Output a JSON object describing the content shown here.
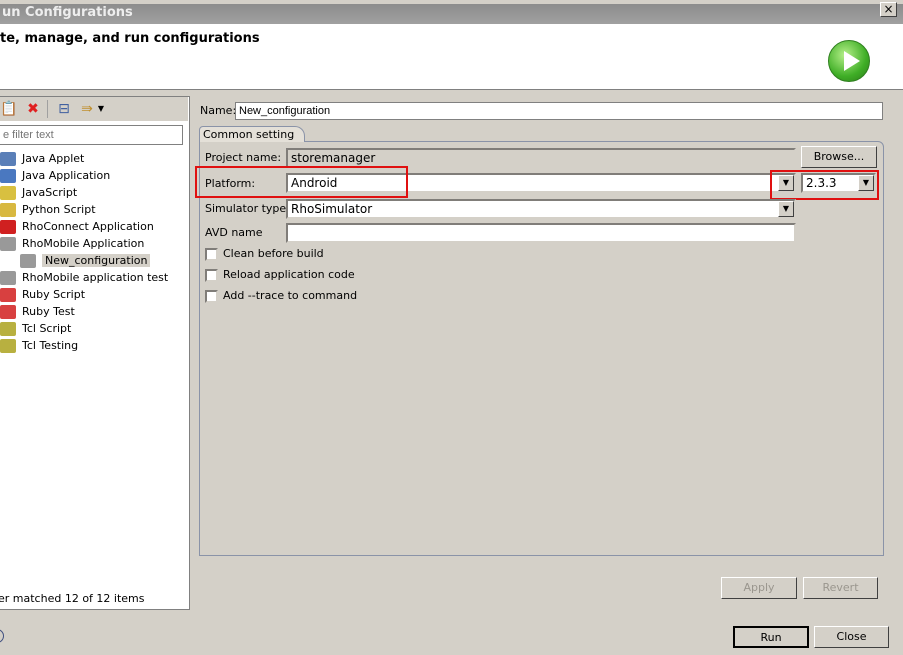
{
  "window": {
    "title": "un Configurations",
    "close": "×"
  },
  "header": {
    "title": "te, manage, and run configurations",
    "run_icon": "green-run-icon"
  },
  "toolbar": {
    "icons": [
      "duplicate-icon",
      "delete-icon",
      "collapse-all-icon",
      "filter-icon",
      "dropdown-arrow-icon"
    ]
  },
  "filter": {
    "placeholder": "e filter text"
  },
  "tree": {
    "items": [
      {
        "label": "Java Applet",
        "icon": "java-applet-icon",
        "color": "#5a7fb8"
      },
      {
        "label": "Java Application",
        "icon": "java-app-icon",
        "color": "#4a78c0"
      },
      {
        "label": "JavaScript",
        "icon": "javascript-icon",
        "color": "#d8c040"
      },
      {
        "label": "Python Script",
        "icon": "python-icon",
        "color": "#d8b840"
      },
      {
        "label": "RhoConnect Application",
        "icon": "rhoconnect-icon",
        "color": "#d02020"
      },
      {
        "label": "RhoMobile Application",
        "icon": "rhomobile-icon",
        "color": "#999999"
      },
      {
        "label": "New_configuration",
        "icon": "rhomobile-icon",
        "color": "#999999",
        "child": true,
        "selected": true
      },
      {
        "label": "RhoMobile application test",
        "icon": "rhomobile-icon",
        "color": "#999999"
      },
      {
        "label": "Ruby Script",
        "icon": "ruby-icon",
        "color": "#d84040"
      },
      {
        "label": "Ruby Test",
        "icon": "ruby-test-icon",
        "color": "#d84040"
      },
      {
        "label": "Tcl Script",
        "icon": "tcl-icon",
        "color": "#b8b040"
      },
      {
        "label": "Tcl Testing",
        "icon": "tcl-icon",
        "color": "#b8b040"
      }
    ]
  },
  "status": "er matched 12 of 12 items",
  "name": {
    "label": "Name:",
    "value": "New_configuration"
  },
  "tab": {
    "label": "Common setting"
  },
  "form": {
    "project_label": "Project name:",
    "project_value": "storemanager",
    "browse": "Browse...",
    "platform_label": "Platform:",
    "platform_value": "Android",
    "version_value": "2.3.3",
    "simulator_label": "Simulator type:",
    "simulator_value": "RhoSimulator",
    "avd_label": "AVD name",
    "avd_value": "",
    "checkboxes": [
      {
        "label": "Clean before build",
        "checked": false
      },
      {
        "label": "Reload application code",
        "checked": false
      },
      {
        "label": "Add --trace to command",
        "checked": false
      }
    ]
  },
  "buttons": {
    "apply": "Apply",
    "revert": "Revert",
    "run": "Run",
    "close": "Close"
  },
  "highlight_color": "#e01010"
}
